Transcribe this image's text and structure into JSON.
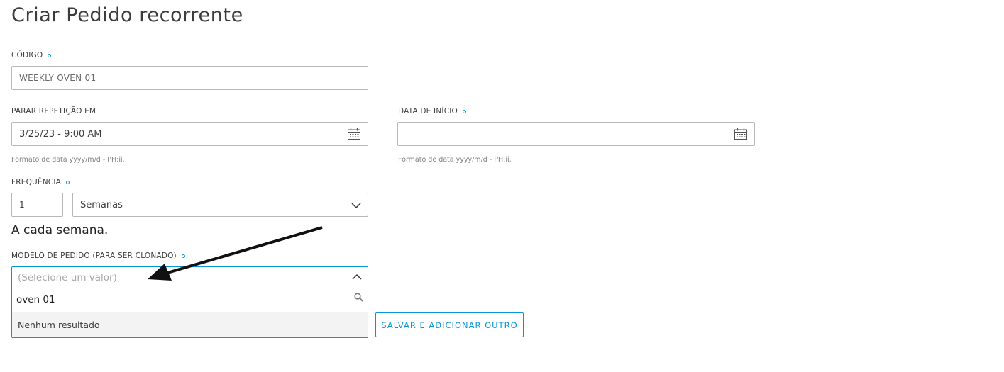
{
  "page": {
    "title": "Criar Pedido recorrente"
  },
  "codigo": {
    "label": "CÓDIGO",
    "value": "WEEKLY OVEN 01"
  },
  "parar_repeticao": {
    "label": "PARAR REPETIÇÃO EM",
    "value": "3/25/23 - 9:00 AM",
    "hint": "Formato de data yyyy/m/d - PH:ii."
  },
  "data_inicio": {
    "label": "DATA DE INÍCIO",
    "value": "",
    "hint": "Formato de data yyyy/m/d - PH:ii."
  },
  "frequencia": {
    "label": "FREQUÊNCIA",
    "count": "1",
    "unit": "Semanas",
    "helper": "A cada semana."
  },
  "modelo": {
    "label": "MODELO DE PEDIDO (PARA SER CLONADO)",
    "placeholder": "(Selecione um valor)",
    "search": "oven 01",
    "no_result": "Nenhum resultado"
  },
  "actions": {
    "save_add": "SALVAR E ADICIONAR OUTRO"
  },
  "colors": {
    "accent": "#0696d7",
    "border": "#b8b8b8",
    "text": "#3c3c3c"
  },
  "icons": [
    "calendar-icon",
    "chevron-down-icon",
    "chevron-up-icon",
    "search-icon",
    "annotation-arrow"
  ]
}
